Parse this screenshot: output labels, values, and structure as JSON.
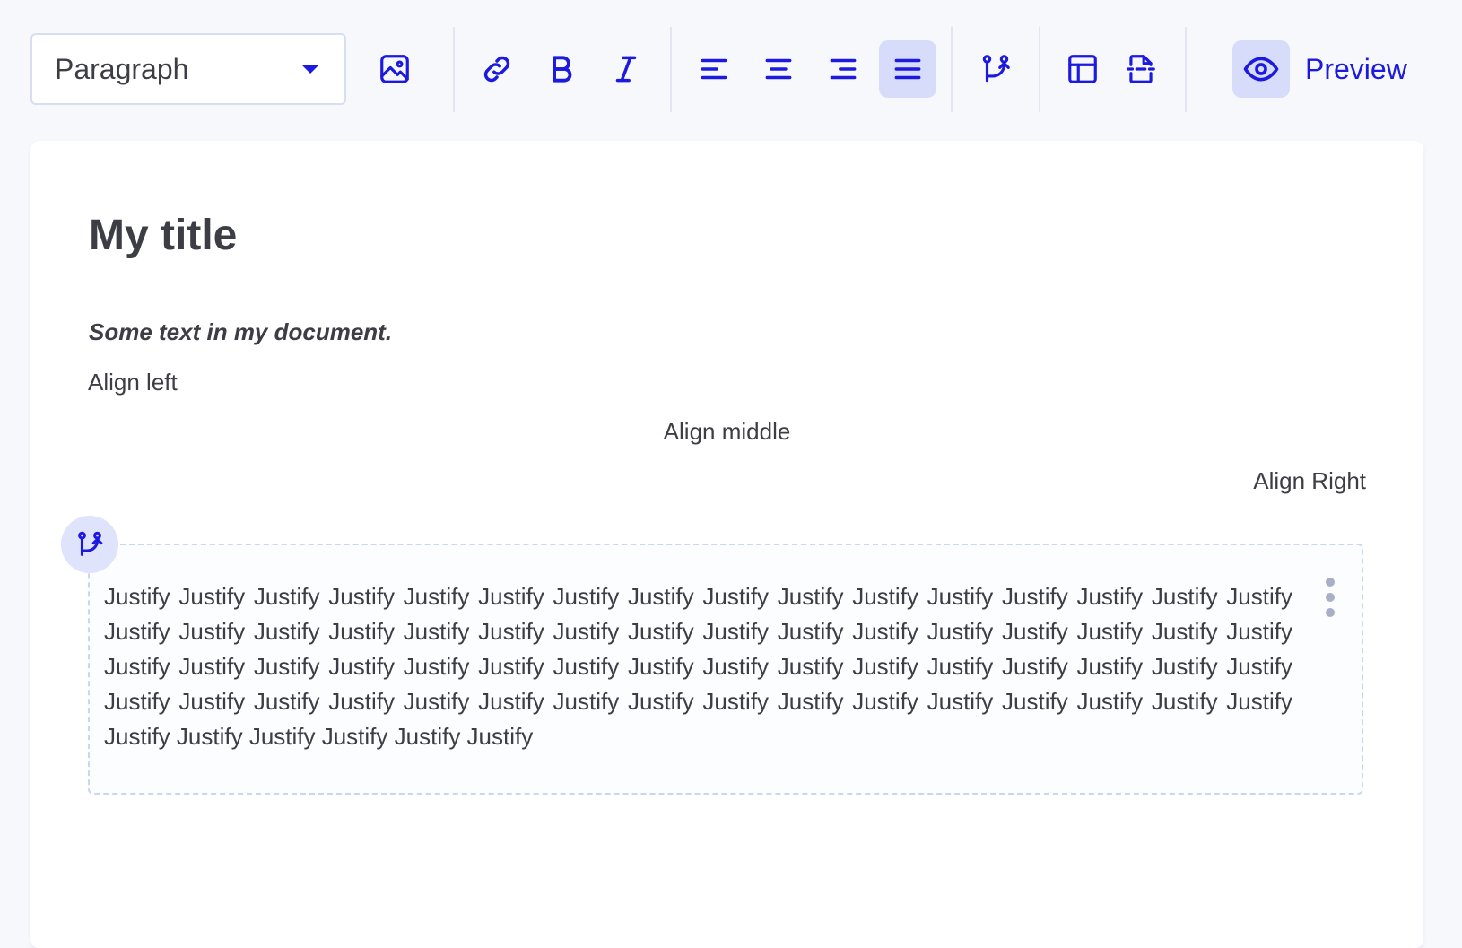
{
  "toolbar": {
    "block_type_select": {
      "value": "Paragraph"
    },
    "buttons": [
      {
        "name": "image",
        "icon": "image-icon"
      },
      {
        "name": "link",
        "icon": "link-icon"
      },
      {
        "name": "bold",
        "icon": "bold-icon"
      },
      {
        "name": "italic",
        "icon": "italic-icon"
      },
      {
        "name": "align-left",
        "icon": "align-left-icon"
      },
      {
        "name": "align-center",
        "icon": "align-center-icon"
      },
      {
        "name": "align-right",
        "icon": "align-right-icon"
      },
      {
        "name": "align-justify",
        "icon": "align-justify-icon",
        "active": true
      },
      {
        "name": "conditional",
        "icon": "git-branch-icon"
      },
      {
        "name": "table",
        "icon": "table-icon"
      },
      {
        "name": "page-break",
        "icon": "page-break-icon"
      }
    ],
    "preview_label": "Preview"
  },
  "document": {
    "title": "My title",
    "subtitle": "Some text in my document.",
    "align_left": "Align left",
    "align_middle": "Align middle",
    "align_right": "Align Right",
    "justify_block": {
      "text": "Justify Justify Justify Justify Justify Justify Justify Justify Justify Justify Justify Justify Justify Justify Justify Justify Justify Justify Justify Justify Justify Justify Justify Justify Justify Justify Justify Justify Justify Justify Justify Justify Justify Justify Justify Justify Justify Justify Justify Justify Justify Justify Justify Justify Justify Justify Justify Justify Justify Justify Justify Justify Justify Justify Justify Justify Justify Justify Justify Justify Justify Justify Justify Justify Justify Justify Justify Justify Justify Justify"
    }
  },
  "colors": {
    "accent": "#1d1ae0",
    "active_bg": "#d7dcfb",
    "page_bg": "#f7f8fc",
    "text": "#3d3d45"
  }
}
